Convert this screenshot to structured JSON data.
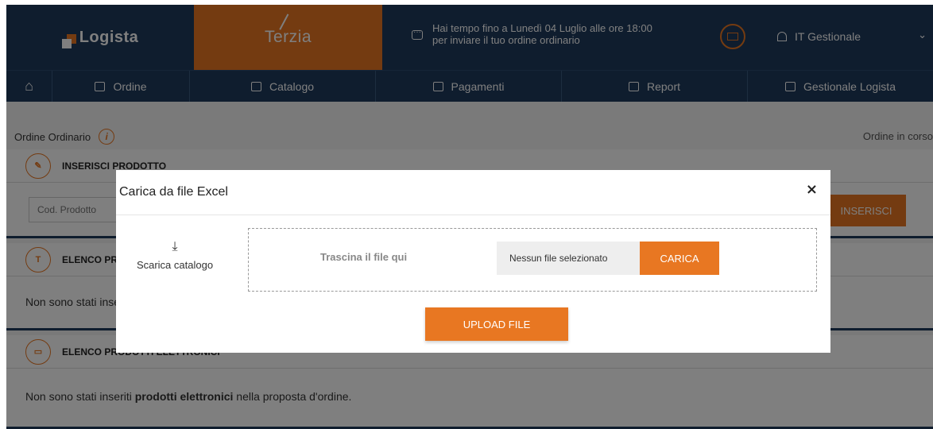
{
  "brand": {
    "logista": "Logista",
    "terzia": "Terzia"
  },
  "header": {
    "deadline_line1": "Hai tempo fino a Lunedì 04 Luglio alle ore 18:00",
    "deadline_line2": "per inviare il tuo ordine ordinario",
    "user": "IT Gestionale"
  },
  "nav": {
    "items": [
      {
        "label": "Ordine",
        "icon": "cart-icon"
      },
      {
        "label": "Catalogo",
        "icon": "catalog-icon"
      },
      {
        "label": "Pagamenti",
        "icon": "card-icon"
      },
      {
        "label": "Report",
        "icon": "report-icon"
      },
      {
        "label": "Gestionale Logista",
        "icon": "monitor-icon"
      }
    ]
  },
  "subheader": {
    "title": "Ordine Ordinario",
    "status": "Ordine in corso"
  },
  "sections": {
    "inserisci": {
      "title": "INSERISCI PRODOTTO",
      "input_placeholder": "Cod. Prodotto",
      "button": "INSERISCI"
    },
    "tabacchi": {
      "title": "ELENCO PRODOTTI TABACCHI",
      "empty": "Non sono stati inseriti prodotti tabacchi nella proposta d'ordine."
    },
    "elettronici": {
      "title": "ELENCO PRODOTTI ELETTRONICI",
      "empty_pre": "Non sono stati inseriti ",
      "empty_bold": "prodotti elettronici",
      "empty_post": " nella proposta d'ordine."
    }
  },
  "modal": {
    "title": "Carica da file Excel",
    "close": "×",
    "download_label": "Scarica catalogo",
    "drop_text": "Trascina il file qui",
    "file_status": "Nessun file selezionato",
    "carica_button": "CARICA",
    "upload_button": "UPLOAD FILE"
  },
  "colors": {
    "navy": "#1f3a5c",
    "orange": "#e87722"
  }
}
